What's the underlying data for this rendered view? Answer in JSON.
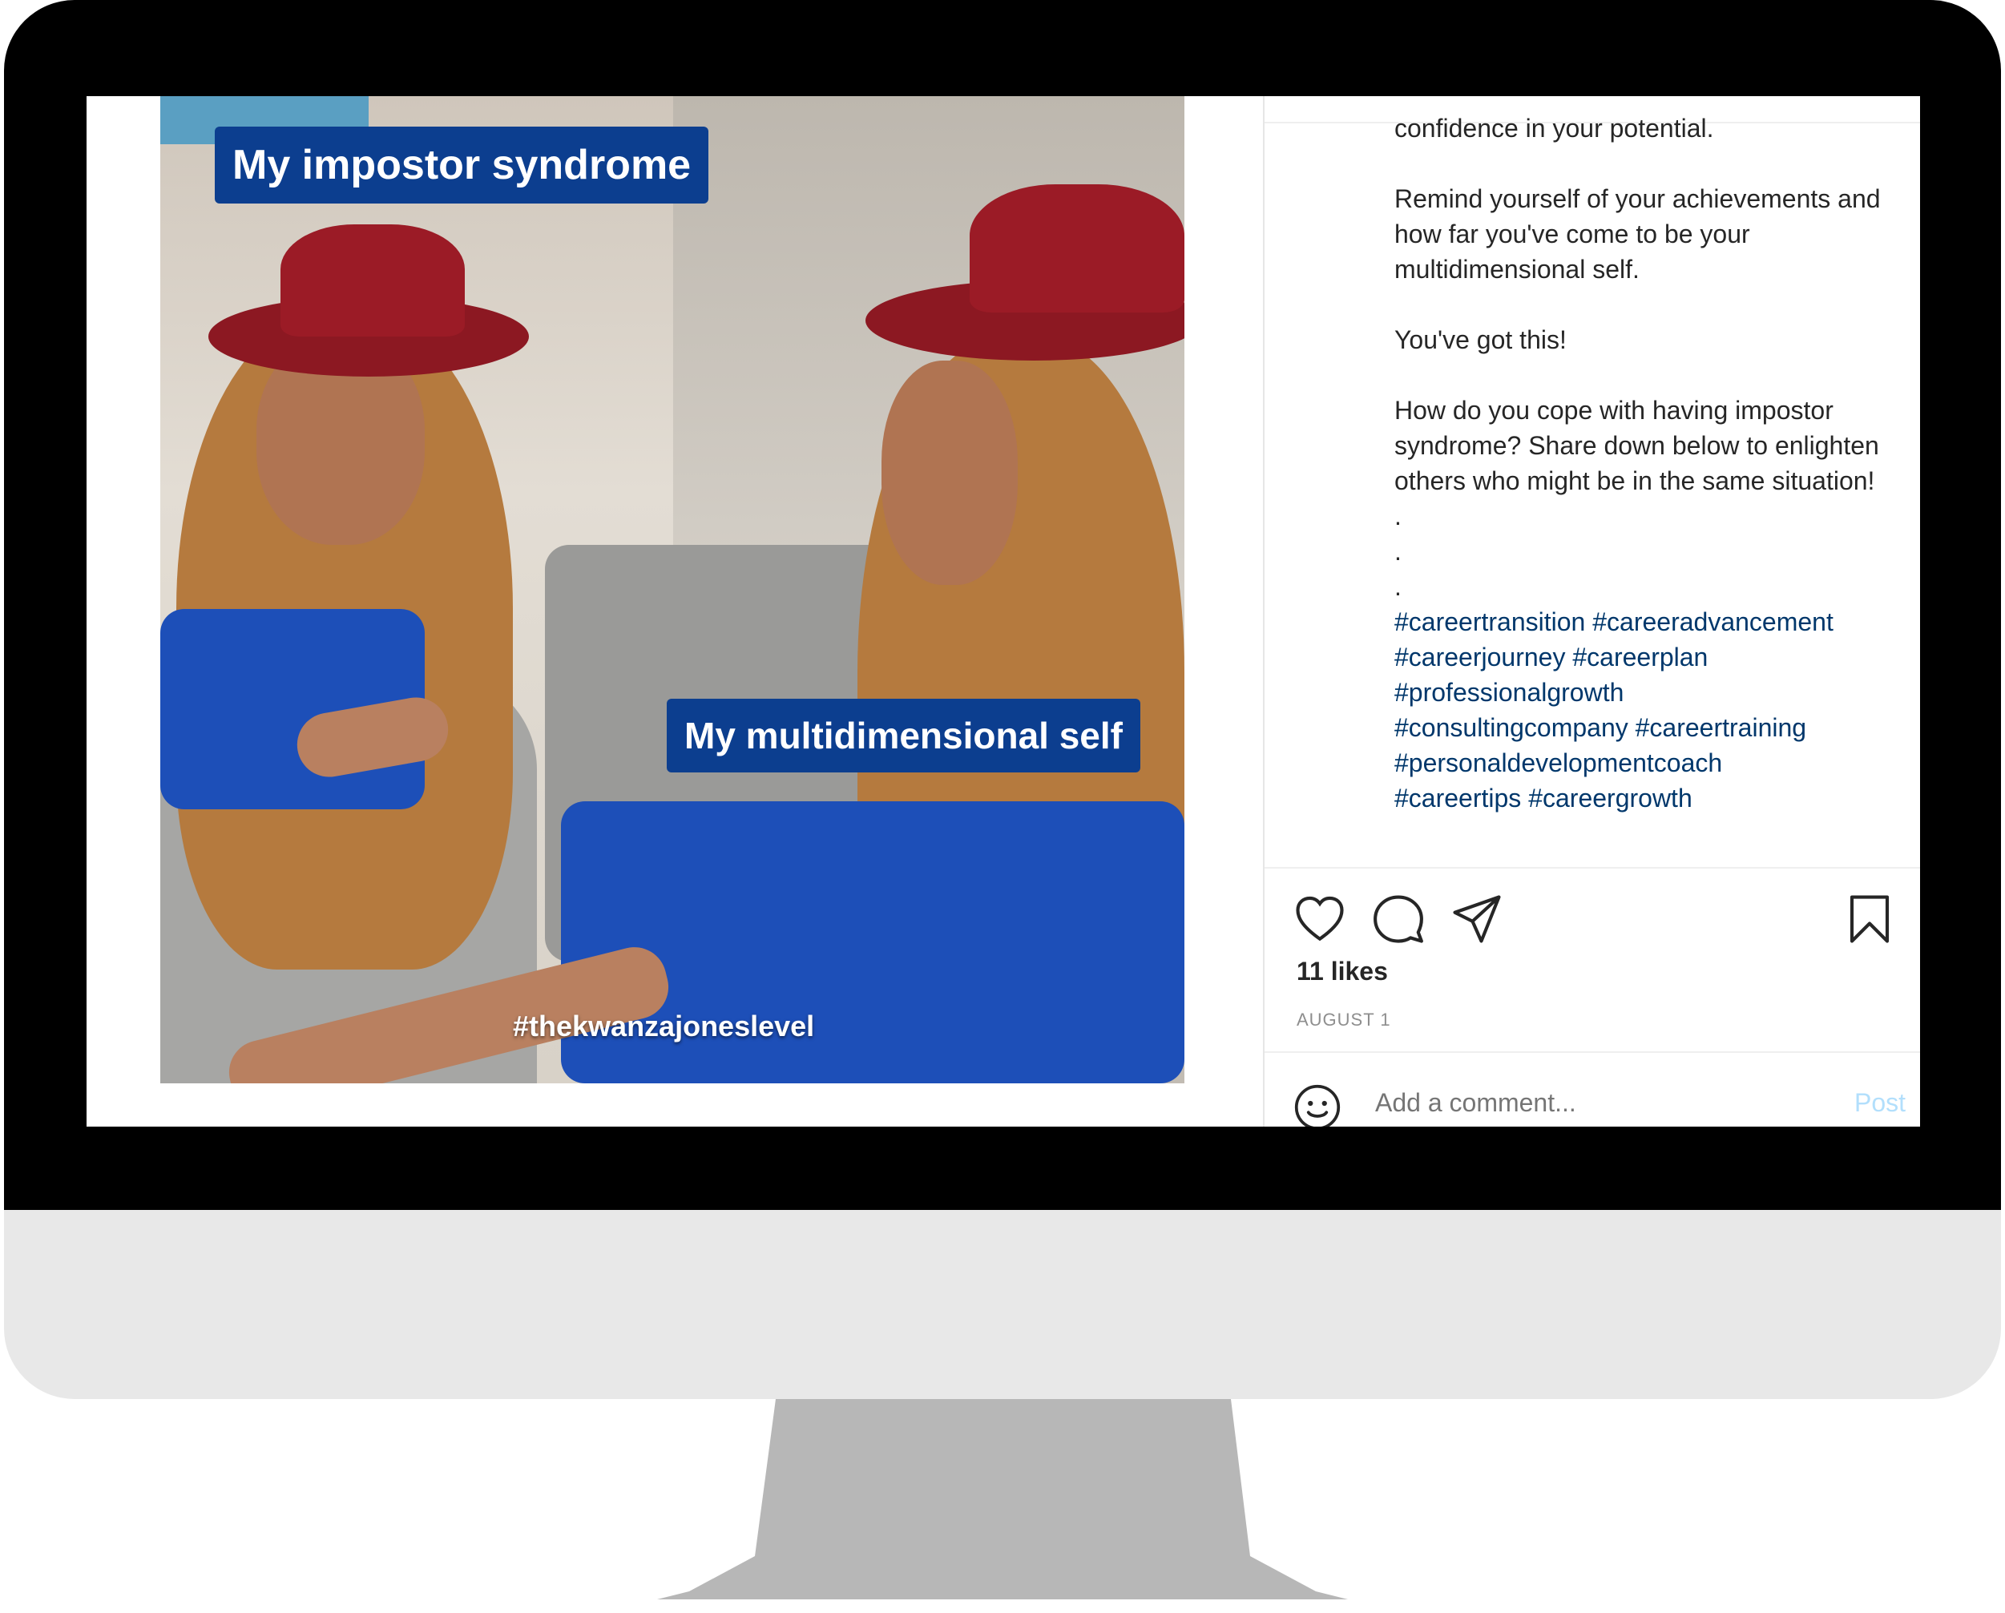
{
  "post": {
    "image_captions": {
      "top": "My impostor syndrome",
      "middle": "My multidimensional self",
      "watermark": "#thekwanzajoneslevel"
    },
    "caption": {
      "line_cut": "confidence in your potential.",
      "para1": "Remind yourself of your achievements and how far you've come to be your multidimensional self.",
      "para2": "You've got this!",
      "para3": "How do you cope with having impostor syndrome? Share down below to enlighten others who might be in the same situation!",
      "dots": [
        ".",
        ".",
        "."
      ],
      "hashtags": [
        "#careertransition #careeradvancement",
        "#careerjourney #careerplan",
        "#professionalgrowth",
        "#consultingcompany #careertraining",
        "#personaldevelopmentcoach",
        "#careertips #careergrowth"
      ]
    },
    "actions": {
      "like_icon": "heart-icon",
      "comment_icon": "comment-icon",
      "share_icon": "send-icon",
      "save_icon": "bookmark-icon"
    },
    "likes": "11 likes",
    "date": "AUGUST 1",
    "comment": {
      "placeholder": "Add a comment...",
      "post_label": "Post"
    }
  },
  "colors": {
    "caption_box": "#0c3e8f",
    "hashtag": "#00376b",
    "post_button_disabled": "#b2dffc",
    "hat": "#9b1b26",
    "dress": "#1d4fb8"
  }
}
